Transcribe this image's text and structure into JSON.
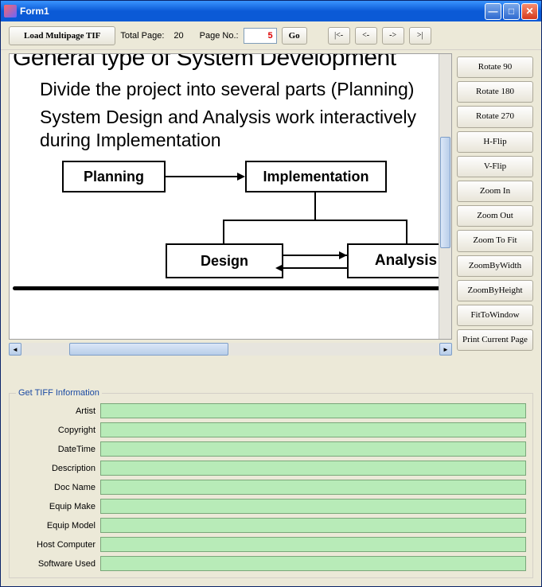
{
  "titlebar": {
    "title": "Form1"
  },
  "toolbar": {
    "load_label": "Load Multipage TIF",
    "total_page_label": "Total Page:",
    "total_page_value": "20",
    "page_no_label": "Page No.:",
    "page_no_value": "5",
    "go_label": "Go",
    "nav_first": "|<-",
    "nav_prev": "<-",
    "nav_next": "->",
    "nav_last": ">|"
  },
  "sidebar": {
    "buttons": [
      "Rotate 90",
      "Rotate 180",
      "Rotate 270",
      "H-Flip",
      "V-Flip",
      "Zoom In",
      "Zoom Out",
      "Zoom To Fit",
      "ZoomByWidth",
      "ZoomByHeight",
      "FitToWindow",
      "Print Current Page"
    ]
  },
  "document": {
    "title": "General type of System Development",
    "para1": "Divide the project into several parts (Planning)",
    "para2": "System Design and Analysis work interactively during Implementation",
    "box_planning": "Planning",
    "box_implementation": "Implementation",
    "box_design": "Design",
    "box_analysis": "Analysis"
  },
  "info": {
    "group_title": "Get TIFF Information",
    "fields": [
      {
        "label": "Artist",
        "value": ""
      },
      {
        "label": "Copyright",
        "value": ""
      },
      {
        "label": "DateTime",
        "value": ""
      },
      {
        "label": "Description",
        "value": ""
      },
      {
        "label": "Doc Name",
        "value": ""
      },
      {
        "label": "Equip Make",
        "value": ""
      },
      {
        "label": "Equip Model",
        "value": ""
      },
      {
        "label": "Host Computer",
        "value": ""
      },
      {
        "label": "Software Used",
        "value": ""
      }
    ]
  }
}
